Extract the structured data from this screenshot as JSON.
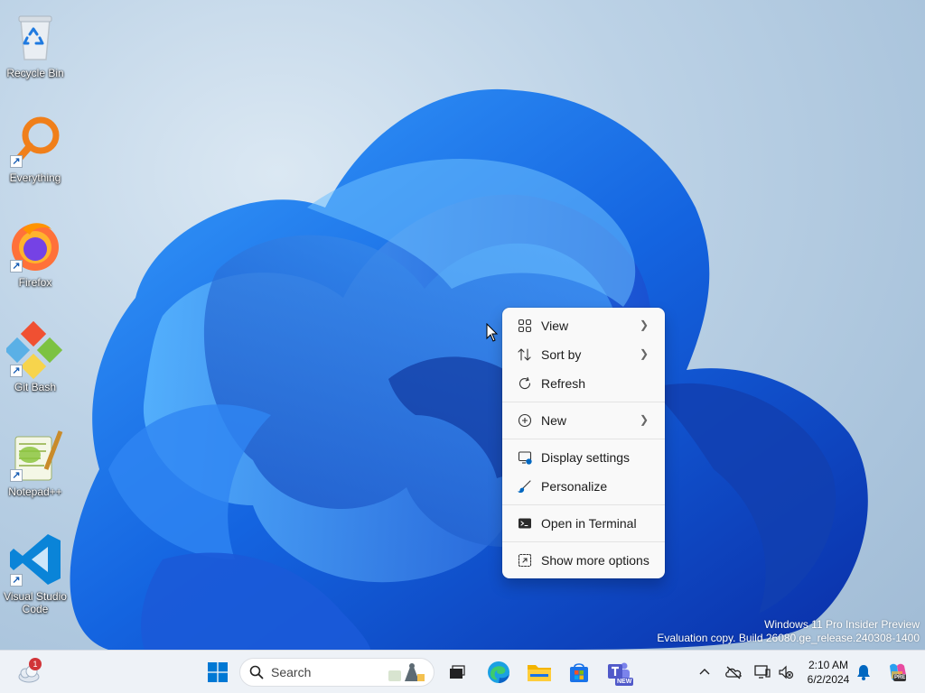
{
  "desktop": {
    "icons": [
      {
        "label": "Recycle Bin"
      },
      {
        "label": "Everything"
      },
      {
        "label": "Firefox"
      },
      {
        "label": "Git Bash"
      },
      {
        "label": "Notepad++"
      },
      {
        "label": "Visual Studio Code"
      }
    ]
  },
  "context_menu": {
    "items": [
      {
        "label": "View",
        "icon": "view-grid-icon",
        "submenu": true
      },
      {
        "label": "Sort by",
        "icon": "sort-icon",
        "submenu": true
      },
      {
        "label": "Refresh",
        "icon": "refresh-icon",
        "submenu": false
      },
      {
        "label": "New",
        "icon": "plus-circle-icon",
        "submenu": true
      },
      {
        "label": "Display settings",
        "icon": "display-icon",
        "submenu": false
      },
      {
        "label": "Personalize",
        "icon": "brush-icon",
        "submenu": false
      },
      {
        "label": "Open in Terminal",
        "icon": "terminal-icon",
        "submenu": false
      },
      {
        "label": "Show more options",
        "icon": "expand-icon",
        "submenu": false
      }
    ]
  },
  "watermark": {
    "line1": "Windows 11 Pro Insider Preview",
    "line2": "Evaluation copy. Build 26080.ge_release.240308-1400"
  },
  "taskbar": {
    "weather_badge": "1",
    "search_placeholder": "Search",
    "apps": [
      "start",
      "search",
      "task-view",
      "edge",
      "file-explorer",
      "store",
      "teams"
    ],
    "teams_badge": "NEW",
    "clock_time": "2:10 AM",
    "clock_date": "6/2/2024",
    "copilot_badge": "PRE"
  },
  "colors": {
    "accent": "#0067c0",
    "wallpaper_blue": "#1a6ae6",
    "menu_bg": "#f9f9f9"
  }
}
